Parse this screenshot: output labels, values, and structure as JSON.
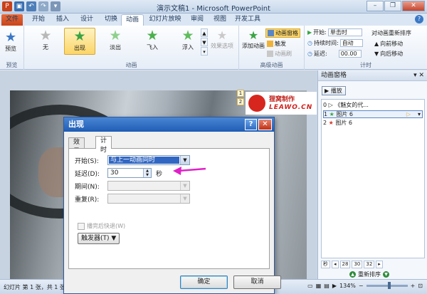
{
  "app": {
    "title": "演示文稿1 - Microsoft PowerPoint"
  },
  "window_controls": {
    "minimize": "–",
    "restore": "❐",
    "close": "✕"
  },
  "tabs": [
    "文件",
    "开始",
    "插入",
    "设计",
    "切换",
    "动画",
    "幻灯片放映",
    "审阅",
    "视图",
    "开发工具"
  ],
  "active_tab": "动画",
  "ribbon": {
    "preview_label": "预览",
    "preview_group": "预览",
    "effects": [
      "无",
      "出现",
      "淡出",
      "飞入",
      "浮入"
    ],
    "selected_effect": "出现",
    "effect_options": "效果选项",
    "animation_group": "动画",
    "add_animation": "添加动画",
    "anim_pane": "动画窗格",
    "trigger": "触发",
    "anim_painter": "动画刷",
    "advanced_group": "高级动画",
    "start_label": "开始:",
    "start_value": "单击时",
    "duration_label": "持续时间:",
    "duration_value": "自动",
    "delay_label": "延迟:",
    "delay_value": "00.00",
    "reorder_title": "对动画重新排序",
    "move_earlier": "向前移动",
    "move_later": "向后移动",
    "timing_group": "计时"
  },
  "slide": {
    "logo_cn": "狸窝制作",
    "logo_en": "LEAWO.CN",
    "markers": [
      "1",
      "2"
    ]
  },
  "anim_pane": {
    "title": "动画窗格",
    "play": "播放",
    "items": [
      {
        "index": "0",
        "label": "《魅女的代..."
      },
      {
        "index": "1",
        "label": "图片 6"
      },
      {
        "index": "2",
        "label": "图片 6"
      }
    ],
    "timeline": {
      "unit": "秒",
      "t1": "28",
      "t2": "30",
      "t3": "32"
    },
    "reorder": "重新排序"
  },
  "status": {
    "slide_info": "幻灯片 第 1 张，共 1 张",
    "zoom": "134%"
  },
  "dialog": {
    "title": "出现",
    "help": "?",
    "close": "✕",
    "tabs": [
      "效果",
      "计时"
    ],
    "active_tab": "计时",
    "start_label": "开始(S):",
    "start_value": "与上一动画同时",
    "delay_label": "延迟(D):",
    "delay_value": "30",
    "delay_unit": "秒",
    "period_label": "期间(N):",
    "repeat_label": "重复(R):",
    "rewind_label": "播完后快退(W)",
    "trigger_label": "触发器(T)",
    "ok": "确定",
    "cancel": "取消"
  },
  "colors": {
    "accent": "#1f5cb5",
    "file_tab": "#d8531f",
    "pointer": "#e020c8",
    "selection": "#3167c3"
  }
}
